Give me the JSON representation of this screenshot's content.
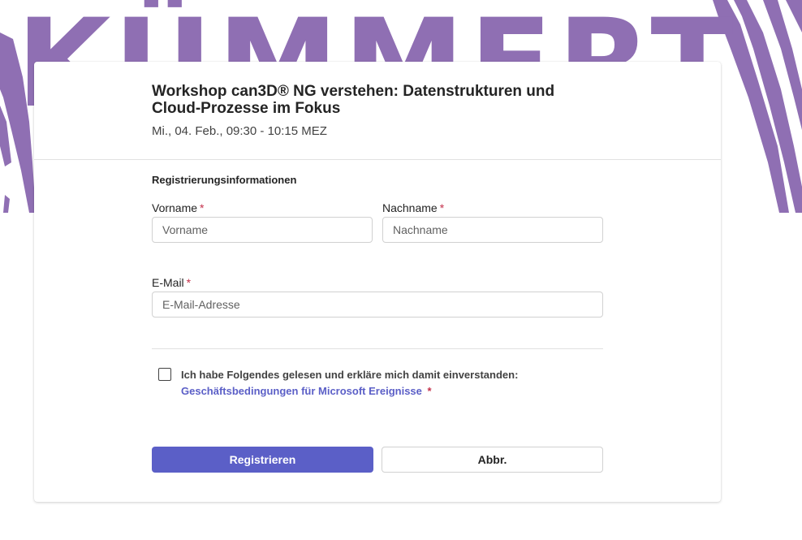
{
  "banner": {
    "background_text": "KÜMMERT",
    "accent_color": "#8f6fb3"
  },
  "event": {
    "title": "Workshop can3D® NG verstehen: Datenstrukturen und Cloud-Prozesse im Fokus",
    "datetime": "Mi., 04. Feb., 09:30 - 10:15 MEZ"
  },
  "form": {
    "section_title": "Registrierungsinformationen",
    "first_name": {
      "label": "Vorname",
      "required_mark": "*",
      "placeholder": "Vorname",
      "value": ""
    },
    "last_name": {
      "label": "Nachname",
      "required_mark": "*",
      "placeholder": "Nachname",
      "value": ""
    },
    "email": {
      "label": "E-Mail",
      "required_mark": "*",
      "placeholder": "E-Mail-Adresse",
      "value": ""
    },
    "consent": {
      "text": "Ich habe Folgendes gelesen und erkläre mich damit einverstanden:",
      "link_text": "Geschäftsbedingungen für Microsoft Ereignisse",
      "required_mark": "*",
      "checked": false
    }
  },
  "actions": {
    "register_label": "Registrieren",
    "cancel_label": "Abbr."
  },
  "colors": {
    "primary": "#5b5fc7",
    "required": "#c4314b",
    "link": "#5b5fc7"
  }
}
